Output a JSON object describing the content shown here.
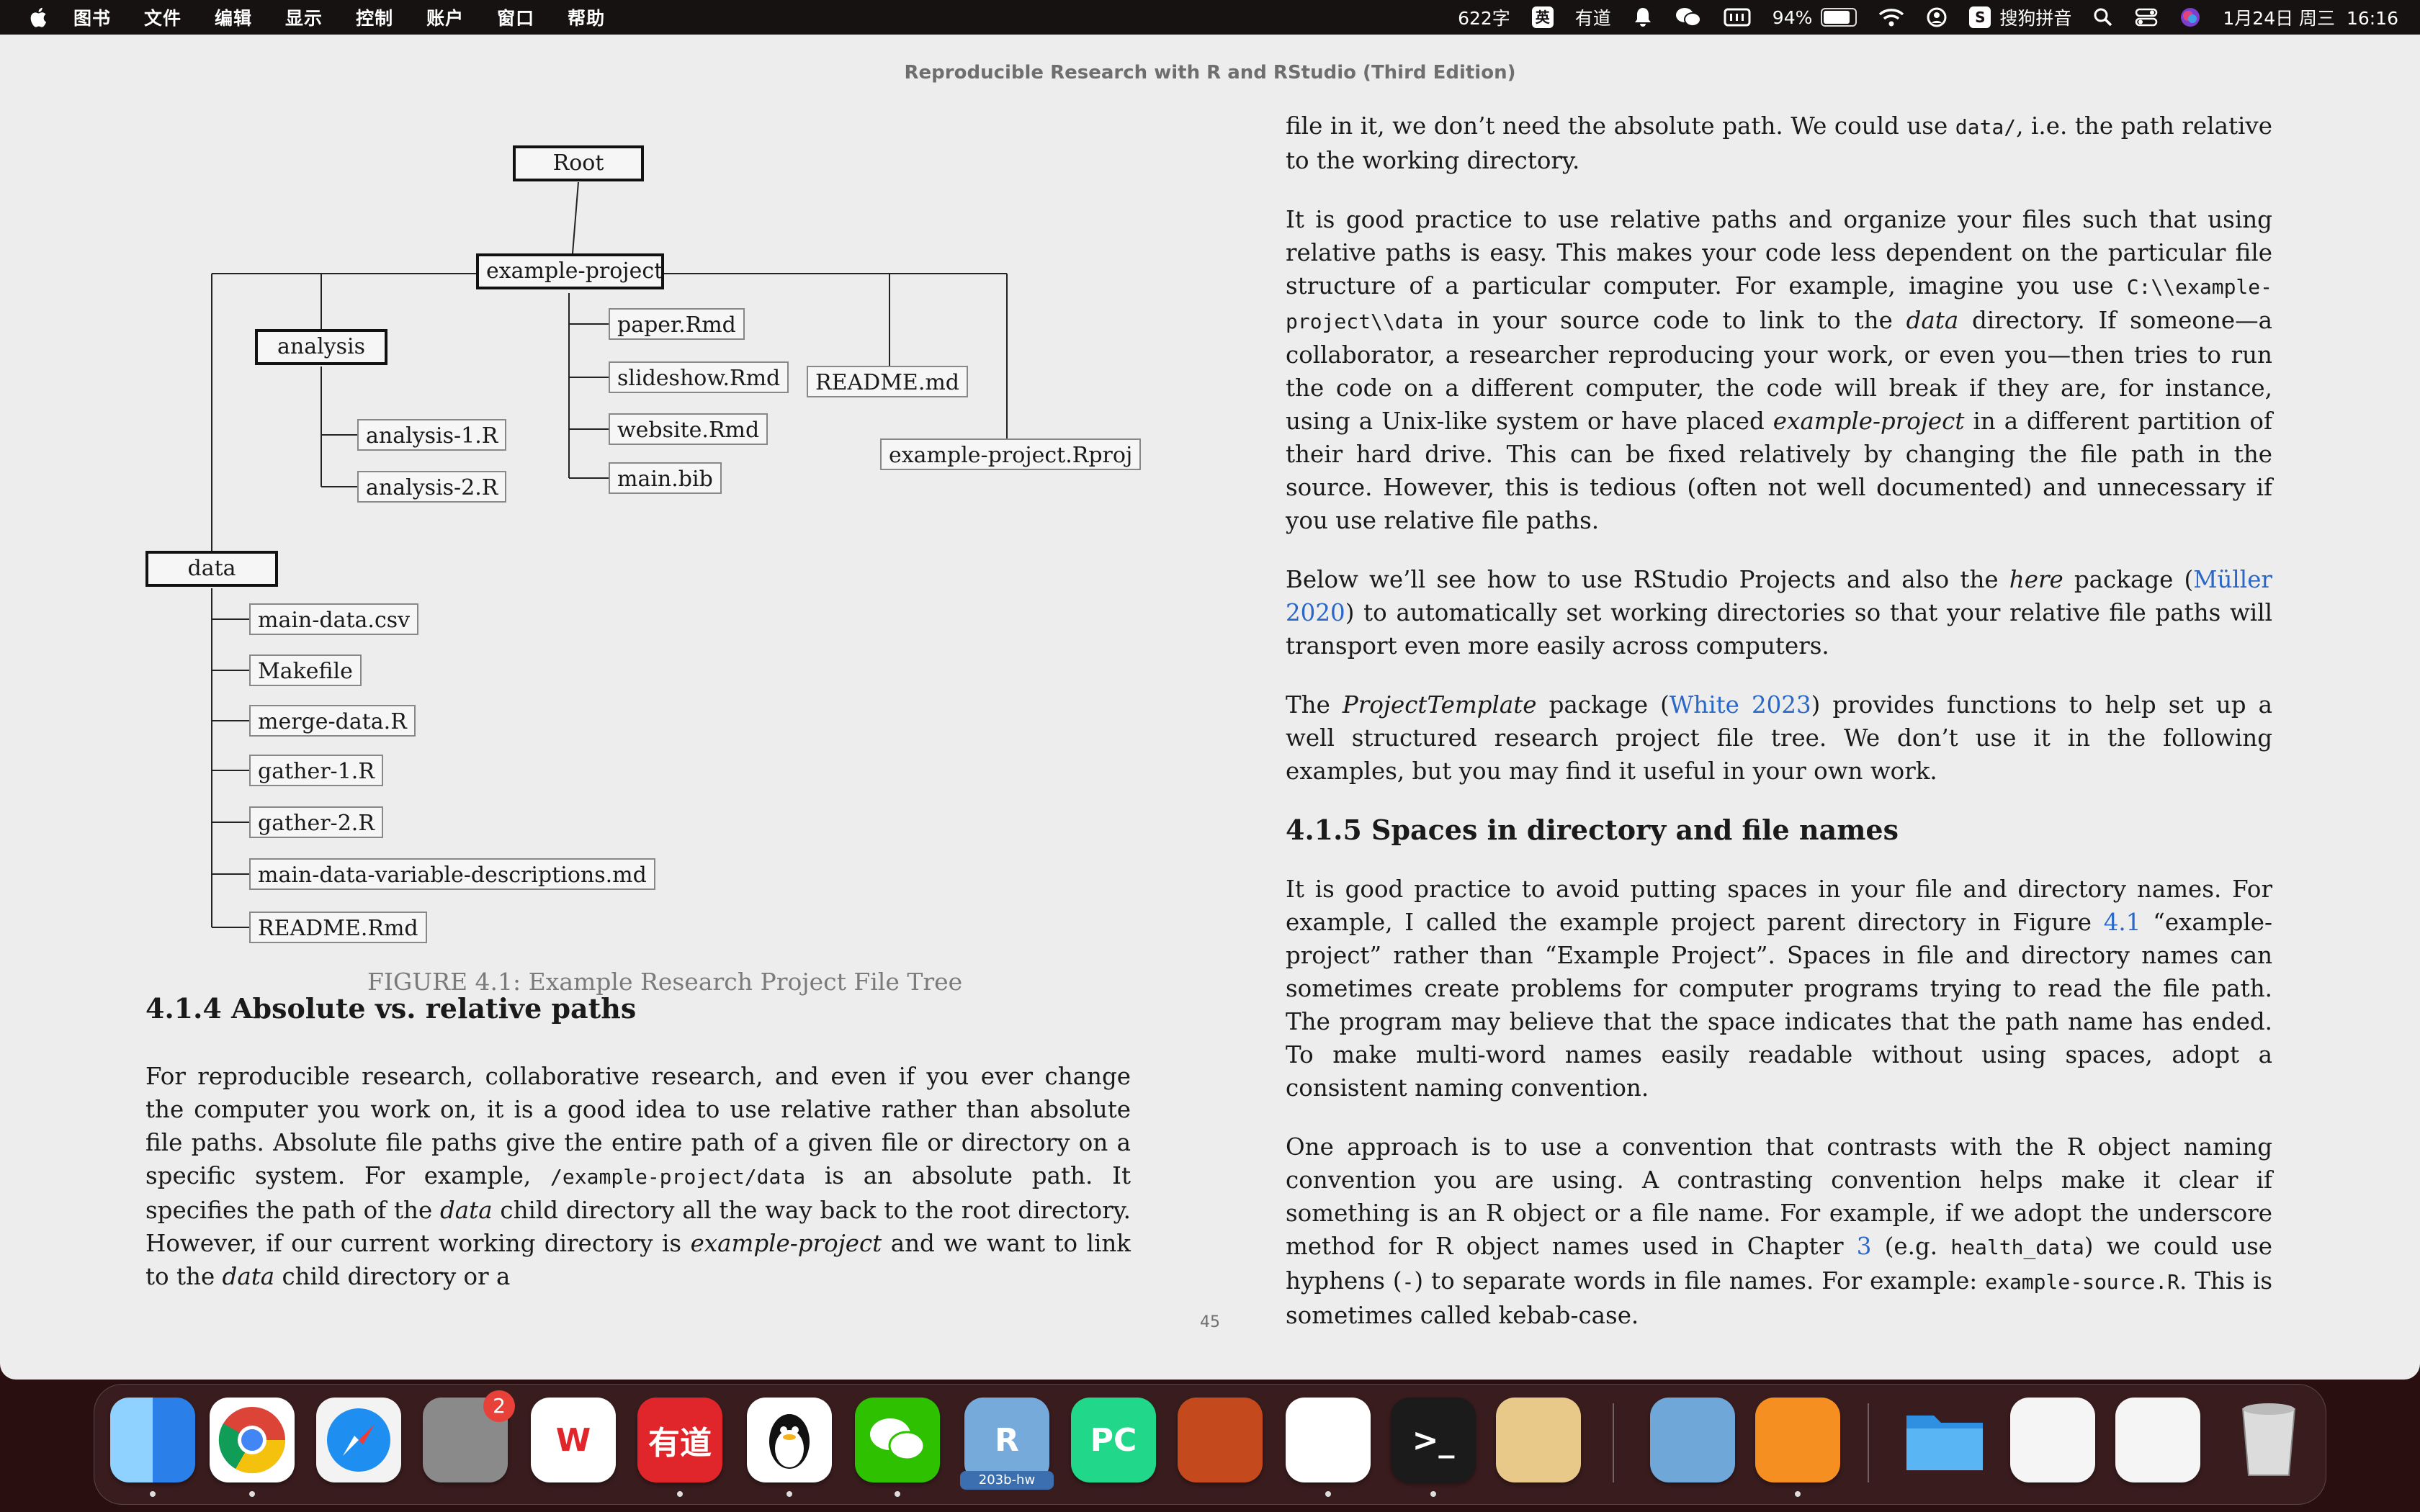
{
  "menubar": {
    "menus": [
      "图书",
      "文件",
      "编辑",
      "显示",
      "控制",
      "账户",
      "窗口",
      "帮助"
    ],
    "status": {
      "word_count": "622字",
      "input_badge": "英",
      "youdao": "有道",
      "battery_pct": "94%",
      "battery_level": 0.94,
      "ime": "搜狗拼音",
      "datetime": "1月24日 周三  16:16"
    }
  },
  "book": {
    "running_title": "Reproducible Research with R and RStudio (Third Edition)",
    "page_number": "45"
  },
  "figure": {
    "nodes": {
      "root": "Root",
      "project": "example-project",
      "analysis": "analysis",
      "analysis1": "analysis-1.R",
      "analysis2": "analysis-2.R",
      "paper": "paper.Rmd",
      "slideshow": "slideshow.Rmd",
      "website": "website.Rmd",
      "mainbib": "main.bib",
      "readme_md": "README.md",
      "rproj": "example-project.Rproj",
      "data": "data",
      "maindata": "main-data.csv",
      "makefile": "Makefile",
      "merge": "merge-data.R",
      "gather1": "gather-1.R",
      "gather2": "gather-2.R",
      "descriptions": "main-data-variable-descriptions.md",
      "readme_rmd": "README.Rmd"
    },
    "caption": "FIGURE 4.1: Example Research Project File Tree"
  },
  "left": {
    "heading": "4.1.4 Absolute vs. relative paths",
    "p1": {
      "a": "For reproducible research, collaborative research, and even if you ever change the computer you work on, it is a good idea to use relative rather than absolute file paths. Absolute file paths give the entire path of a given file or directory on a specific system. For example, ",
      "code": "/example-project/data",
      "b": " is an absolute path. It specifies the path of the ",
      "em1": "data",
      "c": " child directory all the way back to the root directory. However, if our current working directory is ",
      "em2": "example-project",
      "d": " and we want to link to the ",
      "em3": "data",
      "e": " child directory or a"
    }
  },
  "right": {
    "p0": {
      "a": "file in it, we don’t need the absolute path. We could use ",
      "code": "data/",
      "b": ", i.e. the path relative to the working directory."
    },
    "p1": {
      "a": "It is good practice to use relative paths and organize your files such that using relative paths is easy. This makes your code less dependent on the particular file structure of a particular computer. For example, imagine you use ",
      "code": "C:\\\\example-project\\\\data",
      "b": " in your source code to link to the ",
      "em1": "data",
      "c": " directory. If someone—a collaborator, a researcher reproducing your work, or even you—then tries to run the code on a different computer, the code will break if they are, for instance, using a Unix-like system or have placed ",
      "em2": "example-project",
      "d": " in a different partition of their hard drive. This can be fixed relatively by changing the file path in the source. However, this is tedious (often not well documented) and unnecessary if you use relative file paths."
    },
    "p2": {
      "a": "Below we’ll see how to use RStudio Projects and also the ",
      "em": "here",
      "b": " package (",
      "link": "Müller 2020",
      "c": ") to automatically set working directories so that your relative file paths will transport even more easily across computers."
    },
    "p3": {
      "a": "The ",
      "em": "ProjectTemplate",
      "b": " package (",
      "link": "White 2023",
      "c": ") provides functions to help set up a well structured research project file tree. We don’t use it in the following examples, but you may find it useful in your own work."
    },
    "heading": "4.1.5 Spaces in directory and file names",
    "p4": {
      "a": "It is good practice to avoid putting spaces in your file and directory names. For example, I called the example project parent directory in Figure ",
      "link": "4.1",
      "b": " “example-project” rather than “Example Project”. Spaces in file and directory names can sometimes create problems for computer programs trying to read the file path. The program may believe that the space indicates that the path name has ended. To make multi-word names easily readable without using spaces, adopt a consistent naming convention."
    },
    "p5": {
      "a": "One approach is to use a convention that contrasts with the R object naming convention you are using. A contrasting convention helps make it clear if something is an R object or a file name. For example, if we adopt the underscore method for R object names used in Chapter ",
      "link": "3",
      "b": " (e.g. ",
      "code1": "health_data",
      "c": ") we could use hyphens (",
      "code2": "-",
      "d": ") to separate words in file names. For example: ",
      "code3": "example-source.R",
      "e": ". This is sometimes called kebab-case."
    }
  },
  "dock": {
    "apps": [
      {
        "name": "finder",
        "color": "#3d8ef0"
      },
      {
        "name": "chrome",
        "color": "#ffffff"
      },
      {
        "name": "safari",
        "color": "#f3f3f3"
      },
      {
        "name": "system-settings",
        "color": "#8a8a8a",
        "badge": "2"
      },
      {
        "name": "wps",
        "color": "#ffffff",
        "glyph": "W"
      },
      {
        "name": "youdao",
        "color": "#e0262a",
        "glyph": "有道"
      },
      {
        "name": "qq",
        "color": "#ffffff"
      },
      {
        "name": "wechat",
        "color": "#2dc100"
      },
      {
        "name": "rstudio",
        "color": "#75aadb",
        "glyph": "R",
        "label": "203b-hw"
      },
      {
        "name": "pycharm",
        "color": "#21d789",
        "glyph": "PC"
      },
      {
        "name": "matlab",
        "color": "#c44a1d"
      },
      {
        "name": "slack",
        "color": "#ffffff"
      },
      {
        "name": "terminal",
        "color": "#1b1b1b",
        "glyph": ">_"
      },
      {
        "name": "anime-avatar",
        "color": "#e9c98a"
      },
      {
        "name": "preview",
        "color": "#6fa7d8"
      },
      {
        "name": "books",
        "color": "#f58f22"
      },
      {
        "name": "folder",
        "color": "#3ea1f0"
      },
      {
        "name": "chrome-window",
        "color": "#f5f5f5"
      },
      {
        "name": "rstudio-window",
        "color": "#f5f5f5"
      },
      {
        "name": "trash",
        "color": "#c9c9c9"
      }
    ]
  }
}
